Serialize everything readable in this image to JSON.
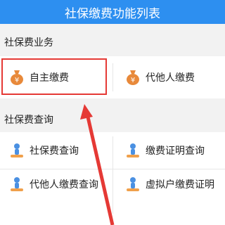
{
  "header": {
    "title": "社保缴费功能列表"
  },
  "sections": [
    {
      "title": "社保费业务",
      "items": [
        {
          "label": "自主缴费",
          "icon": "money-bag-icon"
        },
        {
          "label": "代他人缴费",
          "icon": "money-bag-icon"
        }
      ]
    },
    {
      "title": "社保费查询",
      "items": [
        {
          "label": "社保费查询",
          "icon": "person-query-icon"
        },
        {
          "label": "缴费证明查询",
          "icon": "person-query-icon"
        },
        {
          "label": "代他人缴费查询",
          "icon": "person-query-icon"
        },
        {
          "label": "虚拟户缴费证明",
          "icon": "person-query-icon"
        }
      ]
    }
  ],
  "colors": {
    "header": "#2d8ff0",
    "bag": "#e8893a",
    "highlight": "#e53935",
    "person_blue": "#4a90e2",
    "person_orange": "#f0a04b"
  }
}
